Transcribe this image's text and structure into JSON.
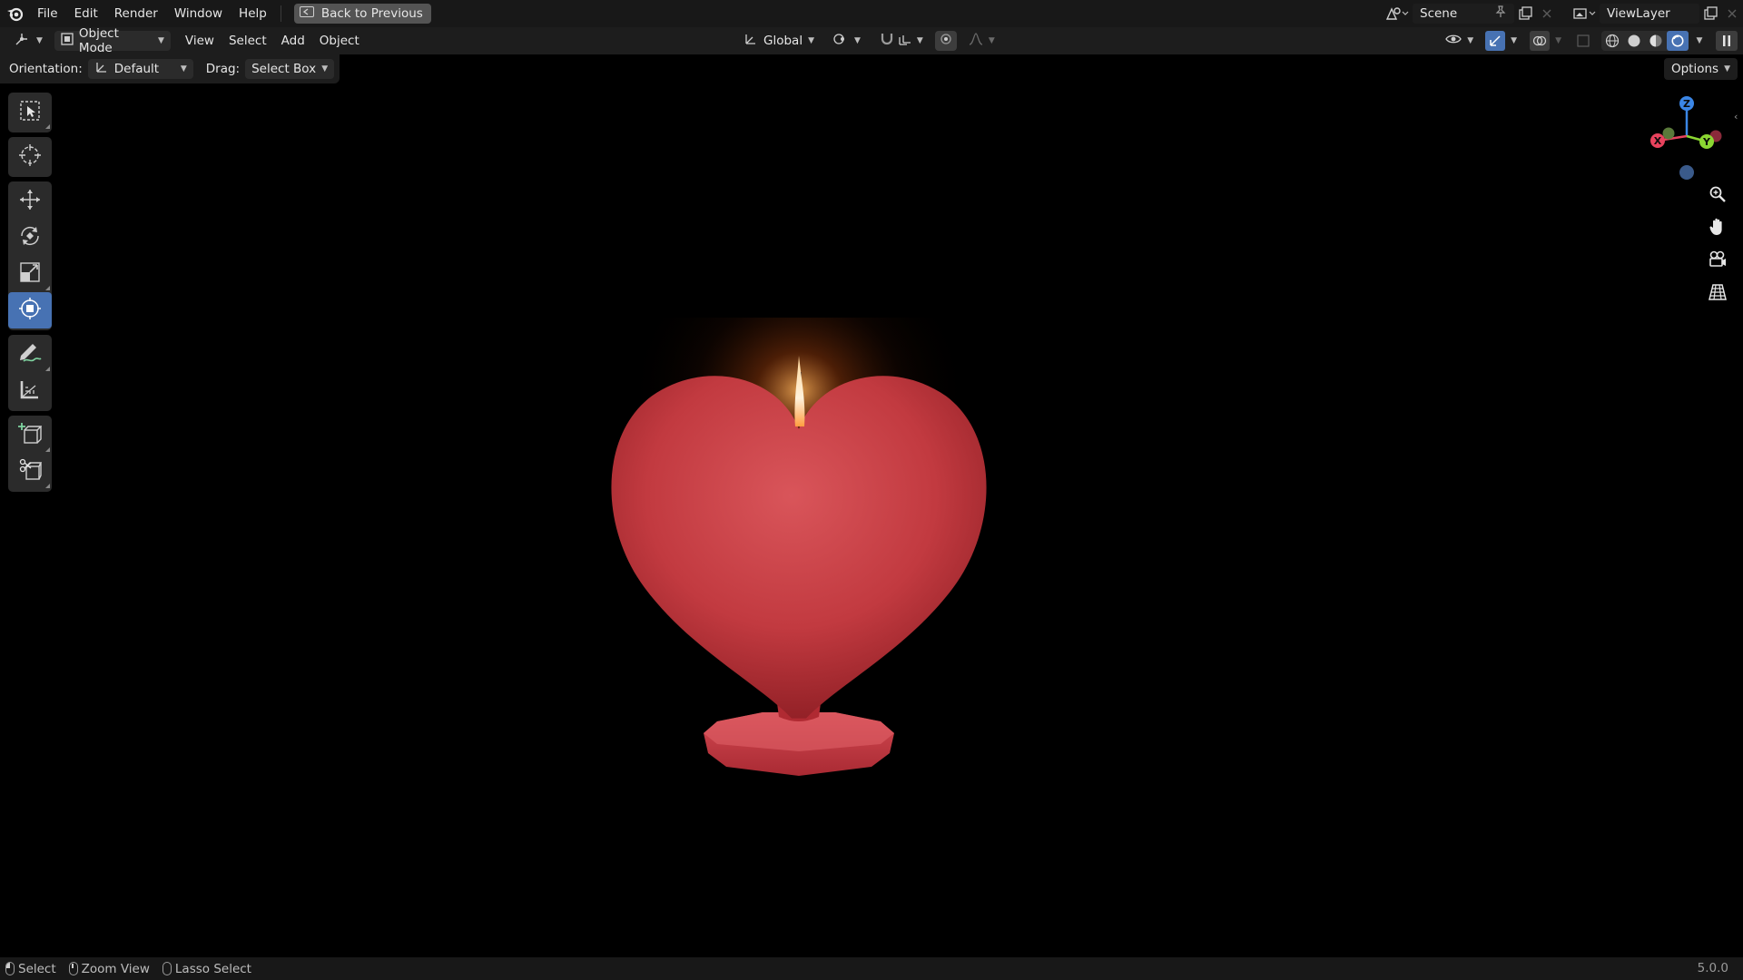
{
  "topbar": {
    "menus": [
      "File",
      "Edit",
      "Render",
      "Window",
      "Help"
    ],
    "back_button": "Back to Previous",
    "scene_name": "Scene",
    "view_layer_name": "ViewLayer"
  },
  "header": {
    "mode": "Object Mode",
    "menus": [
      "View",
      "Select",
      "Add",
      "Object"
    ],
    "transform_orientation": "Global"
  },
  "tool_settings": {
    "orientation_label": "Orientation:",
    "orientation_value": "Default",
    "drag_label": "Drag:",
    "drag_value": "Select Box",
    "options_label": "Options"
  },
  "gizmo": {
    "x_label": "X",
    "y_label": "Y",
    "z_label": "Z"
  },
  "status": {
    "select": "Select",
    "zoom_view": "Zoom View",
    "lasso_select": "Lasso Select",
    "version": "5.0.0"
  },
  "colors": {
    "accent": "#4772b3",
    "axis_x": "#e8425d",
    "axis_y": "#8bd632",
    "axis_z": "#3b86e6",
    "candle": "#c63a42"
  }
}
